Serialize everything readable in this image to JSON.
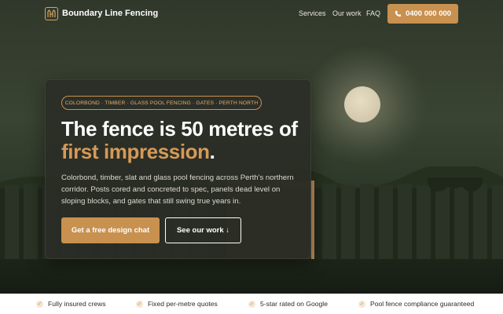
{
  "header": {
    "brand": "Boundary Line Fencing",
    "logo_icon": "fence-logo-icon",
    "nav": [
      "Services",
      "Our work",
      "FAQ"
    ],
    "phone": "0400 000 000",
    "phone_icon": "phone-icon"
  },
  "hero": {
    "tagline": "COLORBOND · TIMBER · GLASS POOL FENCING · GATES · PERTH NORTH",
    "headline_part1": "The fence is 50 metres of",
    "headline_accent": "first impression",
    "headline_end": ".",
    "body": "Colorbond, timber, slat and glass pool fencing across Perth's northern corridor. Posts cored and concreted to spec, panels dead level on sloping blocks, and gates that still swing true years in.",
    "cta_primary": "Get a free design chat",
    "cta_secondary": "See our work ↓"
  },
  "trust": {
    "items": [
      "Fully insured crews",
      "Fixed per-metre quotes",
      "5-star rated on Google",
      "Pool fence compliance guaranteed"
    ],
    "icon": "check-icon"
  },
  "colors": {
    "accent": "#c8914f",
    "accent_text": "#d59a58",
    "card": "#2a2c26",
    "trust_bar": "#ffffff"
  }
}
